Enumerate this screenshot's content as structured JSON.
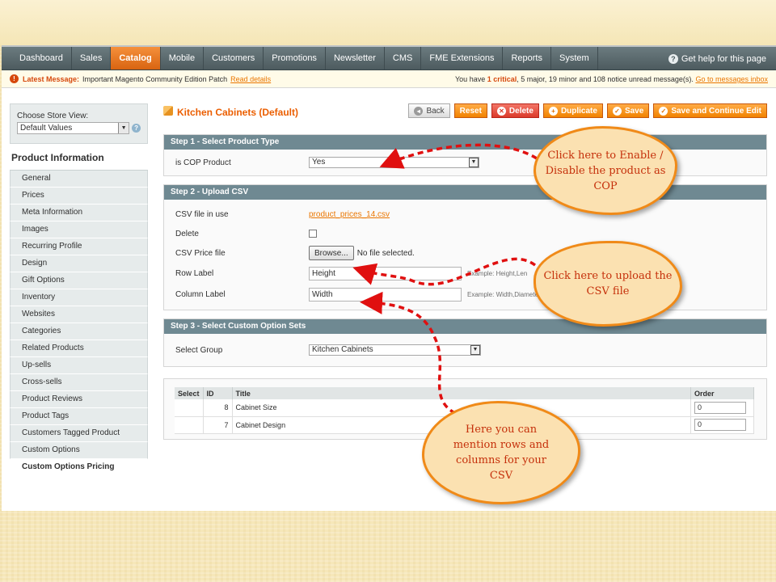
{
  "nav": {
    "items": [
      "Dashboard",
      "Sales",
      "Catalog",
      "Mobile",
      "Customers",
      "Promotions",
      "Newsletter",
      "CMS",
      "FME Extensions",
      "Reports",
      "System"
    ],
    "active": "Catalog",
    "help": "Get help for this page"
  },
  "message": {
    "title": "Latest Message:",
    "text": "Important Magento Community Edition Patch",
    "link": "Read details",
    "right_prefix": "You have",
    "critical_count": "1",
    "critical_word": "critical",
    "rest": ", 5 major, 19 minor and 108 notice unread message(s).",
    "right_link": "Go to messages inbox"
  },
  "sidebar": {
    "store_label": "Choose Store View:",
    "store_value": "Default Values",
    "section_title": "Product Information",
    "items": [
      "General",
      "Prices",
      "Meta Information",
      "Images",
      "Recurring Profile",
      "Design",
      "Gift Options",
      "Inventory",
      "Websites",
      "Categories",
      "Related Products",
      "Up-sells",
      "Cross-sells",
      "Product Reviews",
      "Product Tags",
      "Customers Tagged Product",
      "Custom Options",
      "Custom Options Pricing"
    ]
  },
  "page": {
    "title": "Kitchen Cabinets (Default)",
    "buttons": {
      "back": "Back",
      "reset": "Reset",
      "delete": "Delete",
      "duplicate": "Duplicate",
      "save": "Save",
      "save_continue": "Save and Continue Edit"
    }
  },
  "step1": {
    "title": "Step 1 - Select Product Type",
    "label": "is COP Product",
    "value": "Yes"
  },
  "step2": {
    "title": "Step 2 - Upload CSV",
    "csv_label": "CSV file in use",
    "csv_value": "product_prices_14.csv",
    "delete_label": "Delete",
    "price_label": "CSV Price file",
    "browse": "Browse...",
    "no_file": "No file selected.",
    "row_label": "Row Label",
    "row_value": "Height",
    "row_hint": "Example: Height,Len",
    "col_label": "Column Label",
    "col_value": "Width",
    "col_hint": "Example: Width,Diameter"
  },
  "step3": {
    "title": "Step 3 - Select Custom Option Sets",
    "label": "Select Group",
    "value": "Kitchen Cabinets"
  },
  "table": {
    "headers": [
      "Select",
      "ID",
      "Title",
      "Order"
    ],
    "rows": [
      {
        "id": "8",
        "title": "Cabinet Size",
        "order": "0"
      },
      {
        "id": "7",
        "title": "Cabinet Design",
        "order": "0"
      }
    ]
  },
  "callouts": {
    "cop": "Click here to Enable / Disable the product as COP",
    "csv": "Click here to upload the CSV file",
    "rows": "Here you can mention rows and columns for your CSV"
  }
}
